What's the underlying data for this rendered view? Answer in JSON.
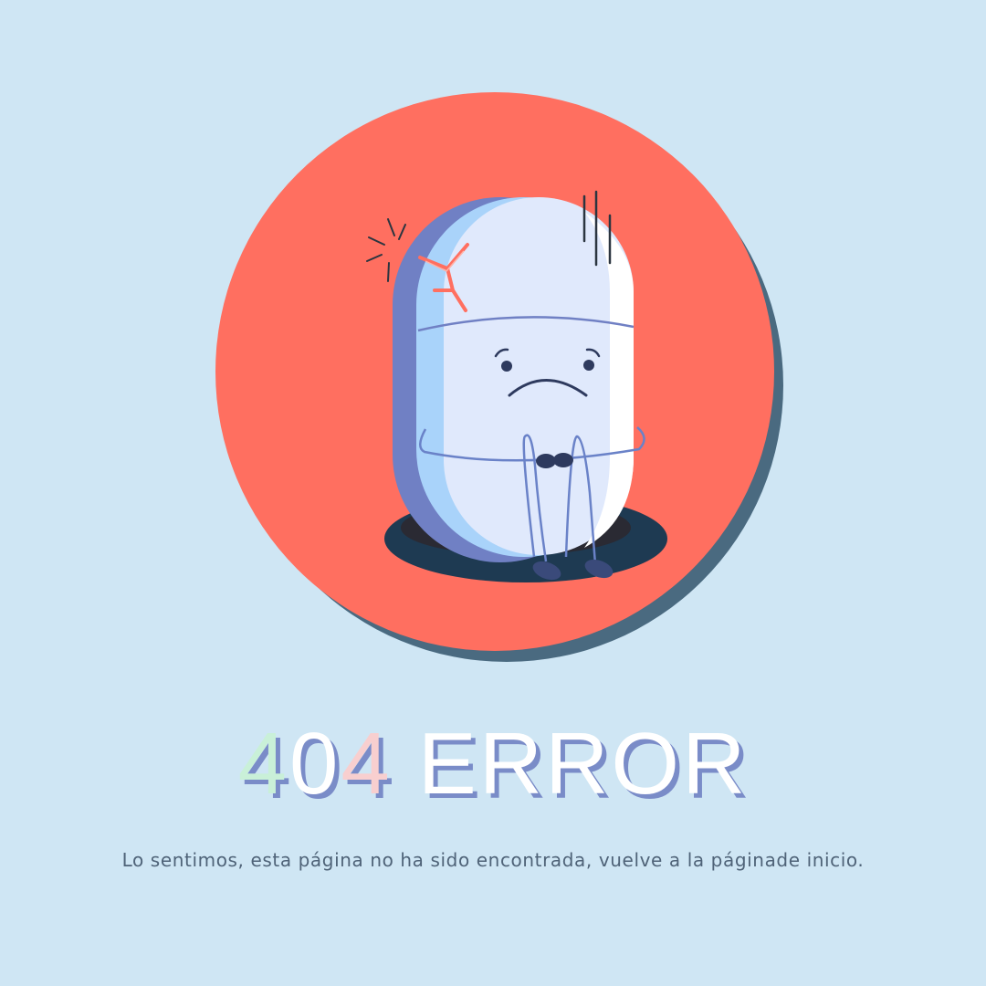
{
  "error": {
    "digit_1": "4",
    "digit_2": "0",
    "digit_3": "4",
    "word": "ERROR"
  },
  "message": "Lo sentimos, esta página no ha sido encontrada, vuelve a la páginade inicio.",
  "illustration": {
    "icon": "sad-pill-character-icon"
  },
  "colors": {
    "background": "#cfe6f4",
    "circle": "#ff6f60",
    "circle_shadow": "#4a6a80",
    "hole": "#1e3a52",
    "character_light": "#e0e9fc",
    "character_mid": "#a9d3fa",
    "character_dark": "#7080c4",
    "crack": "#ff6f60",
    "text": "#4f6378"
  }
}
